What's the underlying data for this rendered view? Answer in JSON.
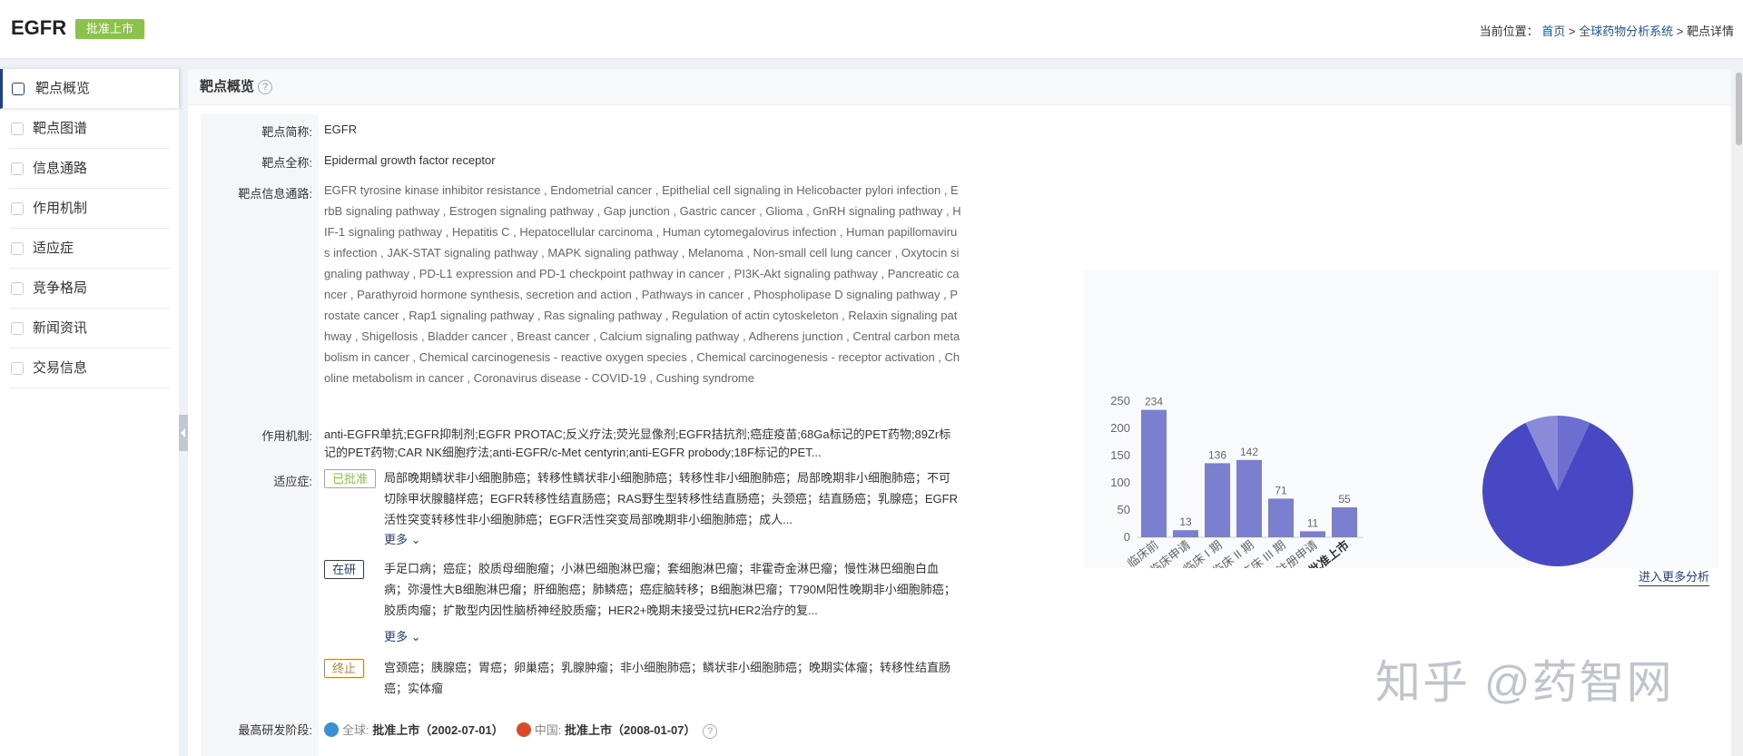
{
  "header": {
    "title": "EGFR",
    "badge": "批准上市",
    "crumb_prefix": "当前位置：",
    "crumb_home": "首页",
    "sep": ">",
    "crumb_system": "全球药物分析系统",
    "crumb_current": "靶点详情"
  },
  "sidebar": {
    "items": [
      {
        "label": "靶点概览",
        "icon": "overview-icon"
      },
      {
        "label": "靶点图谱",
        "icon": "map-icon"
      },
      {
        "label": "信息通路",
        "icon": "pathway-icon"
      },
      {
        "label": "作用机制",
        "icon": "mechanism-icon"
      },
      {
        "label": "适应症",
        "icon": "indication-icon"
      },
      {
        "label": "竞争格局",
        "icon": "competition-icon"
      },
      {
        "label": "新闻资讯",
        "icon": "news-icon"
      },
      {
        "label": "交易信息",
        "icon": "deal-icon"
      }
    ]
  },
  "panel": {
    "title": "靶点概览",
    "help": "?"
  },
  "fields": {
    "short_label": "靶点简称:",
    "short_value": "EGFR",
    "full_label": "靶点全称:",
    "full_value": "Epidermal growth factor receptor",
    "pathway_label": "靶点信息通路:",
    "pathway_value": "EGFR tyrosine kinase inhibitor resistance , Endometrial cancer , Epithelial cell signaling in Helicobacter pylori infection , ErbB signaling pathway , Estrogen signaling pathway , Gap junction , Gastric cancer , Glioma , GnRH signaling pathway , HIF-1 signaling pathway , Hepatitis C , Hepatocellular carcinoma , Human cytomegalovirus infection , Human papillomavirus infection , JAK-STAT signaling pathway , MAPK signaling pathway , Melanoma , Non-small cell lung cancer , Oxytocin signaling pathway , PD-L1 expression and PD-1 checkpoint pathway in cancer , PI3K-Akt signaling pathway , Pancreatic cancer , Parathyroid hormone synthesis, secretion and action , Pathways in cancer , Phospholipase D signaling pathway , Prostate cancer , Rap1 signaling pathway , Ras signaling pathway , Regulation of actin cytoskeleton , Relaxin signaling pathway , Shigellosis , Bladder cancer , Breast cancer , Calcium signaling pathway , Adherens junction , Central carbon metabolism in cancer , Chemical carcinogenesis - reactive oxygen species , Chemical carcinogenesis - receptor activation , Choline metabolism in cancer , Coronavirus disease - COVID-19 , Cushing syndrome",
    "mech_label": "作用机制:",
    "mech_value": "anti-EGFR单抗;EGFR抑制剂;EGFR PROTAC;反义疗法;荧光显像剂;EGFR拮抗剂;癌症疫苗;68Ga标记的PET药物;89Zr标记的PET药物;CAR NK细胞疗法;anti-EGFR/c-Met centyrin;anti-EGFR probody;18F标记的PET...",
    "ind_label": "适应症:",
    "approved_tag": "已批准",
    "approved_text": "局部晚期鳞状非小细胞肺癌；转移性鳞状非小细胞肺癌；转移性非小细胞肺癌；局部晚期非小细胞肺癌；不可切除甲状腺髓样癌；EGFR转移性结直肠癌；RAS野生型转移性结直肠癌；头颈癌；结直肠癌；乳腺癌；EGFR活性突变转移性非小细胞肺癌；EGFR活性突变局部晚期非小细胞肺癌；成人...",
    "research_tag": "在研",
    "research_text": "手足口病；癌症；胶质母细胞瘤；小淋巴细胞淋巴瘤；套细胞淋巴瘤；非霍奇金淋巴瘤；慢性淋巴细胞白血病；弥漫性大B细胞淋巴瘤；肝细胞癌；肺鳞癌；癌症脑转移；B细胞淋巴瘤；T790M阳性晚期非小细胞肺癌；胶质肉瘤；扩散型内因性脑桥神经胶质瘤；HER2+晚期未接受过抗HER2治疗的复...",
    "stopped_tag": "终止",
    "stopped_text": "宫颈癌；胰腺癌；胃癌；卵巢癌；乳腺肿瘤；非小细胞肺癌；鳞状非小细胞肺癌；晚期实体瘤；转移性结直肠癌；实体瘤",
    "more": "更多",
    "stage_label": "最高研发阶段:",
    "global_label": "全球:",
    "global_value": "批准上市（2002-07-01）",
    "china_label": "中国:",
    "china_value": "批准上市（2008-01-07）"
  },
  "more_analysis": "进入更多分析",
  "watermark": "知乎 @药智网",
  "colors": {
    "bar": "#7b7fcf",
    "pie_main": "#4848c4",
    "pie_light": "#6c6fd0",
    "pie_lighter": "#8a8ad8",
    "approved": "#8bc34a",
    "research": "#1e3f86",
    "stopped": "#c97a2e"
  },
  "chart_data": [
    {
      "type": "bar",
      "categories": [
        "临床前",
        "临床申请",
        "临床 I 期",
        "临床 II 期",
        "临床 III 期",
        "注册申请",
        "批准上市"
      ],
      "values": [
        234,
        13,
        136,
        142,
        71,
        11,
        55
      ],
      "ylim": [
        0,
        250
      ],
      "yticks": [
        0,
        50,
        100,
        150,
        200,
        250
      ]
    },
    {
      "type": "pie",
      "slices": [
        {
          "value": 0.86
        },
        {
          "value": 0.07
        },
        {
          "value": 0.07
        }
      ]
    }
  ]
}
